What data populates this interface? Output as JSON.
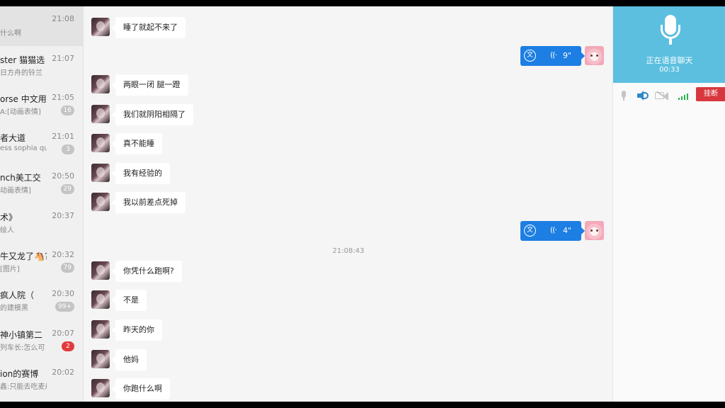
{
  "sidebar": {
    "conversations": [
      {
        "name": "",
        "preview": "什么啊",
        "time": "21:08",
        "badge": "",
        "badge_red": false,
        "active": true
      },
      {
        "name": "ster 猫猫选",
        "preview": "日方舟的铃兰",
        "time": "21:07",
        "badge": "",
        "badge_red": false,
        "active": false
      },
      {
        "name": "orse 中文用",
        "preview": "A:[动画表情]",
        "time": "21:05",
        "badge": "16",
        "badge_red": false,
        "active": false
      },
      {
        "name": "者大道",
        "preview": "ess sophia qu",
        "time": "21:01",
        "badge": "3",
        "badge_red": false,
        "active": false
      },
      {
        "name": "nch美工交",
        "preview": "动画表情]",
        "time": "20:50",
        "badge": "29",
        "badge_red": false,
        "active": false
      },
      {
        "name": "术》",
        "preview": "绘人",
        "time": "20:37",
        "badge": "",
        "badge_red": false,
        "active": false
      },
      {
        "name": "牛又龙了🐴?",
        "preview": "[图片]",
        "time": "20:32",
        "badge": "79",
        "badge_red": false,
        "active": false
      },
      {
        "name": "疯人院（",
        "preview": "的建模黑",
        "time": "20:30",
        "badge": "99+",
        "badge_red": false,
        "active": false
      },
      {
        "name": "神小镇第二",
        "preview": "列车长:怎么可",
        "time": "20:07",
        "badge": "2",
        "badge_red": true,
        "active": false
      },
      {
        "name": "ion的赛博",
        "preview": "鑫:只能去吃麦丹劳了",
        "time": "20:02",
        "badge": "",
        "badge_red": false,
        "active": false
      }
    ]
  },
  "chat": {
    "messages": [
      {
        "kind": "text",
        "text": "睡了就起不来了"
      },
      {
        "kind": "voice",
        "duration": "9\"",
        "translate_glyph": "文",
        "wave_glyph": "((·"
      },
      {
        "kind": "text",
        "text": "两眼一闭 腿一蹬"
      },
      {
        "kind": "text",
        "text": "我们就阴阳相隔了"
      },
      {
        "kind": "text",
        "text": "真不能睡"
      },
      {
        "kind": "text",
        "text": "我有经验的"
      },
      {
        "kind": "text",
        "text": "我以前差点死掉"
      },
      {
        "kind": "voice",
        "duration": "4\"",
        "translate_glyph": "文",
        "wave_glyph": "((·"
      },
      {
        "kind": "time",
        "text": "21:08:43"
      },
      {
        "kind": "text",
        "text": "你凭什么跑啊?"
      },
      {
        "kind": "text",
        "text": "不是"
      },
      {
        "kind": "text",
        "text": "昨天的你"
      },
      {
        "kind": "text",
        "text": "他妈"
      },
      {
        "kind": "text",
        "text": "你跑什么啊"
      }
    ]
  },
  "call": {
    "status": "正在语音聊天",
    "timer": "00:33",
    "hangup_label": "挂断",
    "header_color": "#5cbfe0",
    "controls": [
      "mic-icon",
      "speaker-icon",
      "video-off-icon",
      "signal-icon"
    ]
  },
  "colors": {
    "voice_bubble": "#1d7ee3",
    "hangup": "#d8383d",
    "badge_red": "#e23b3b",
    "badge_gray": "#c4c4c4"
  }
}
